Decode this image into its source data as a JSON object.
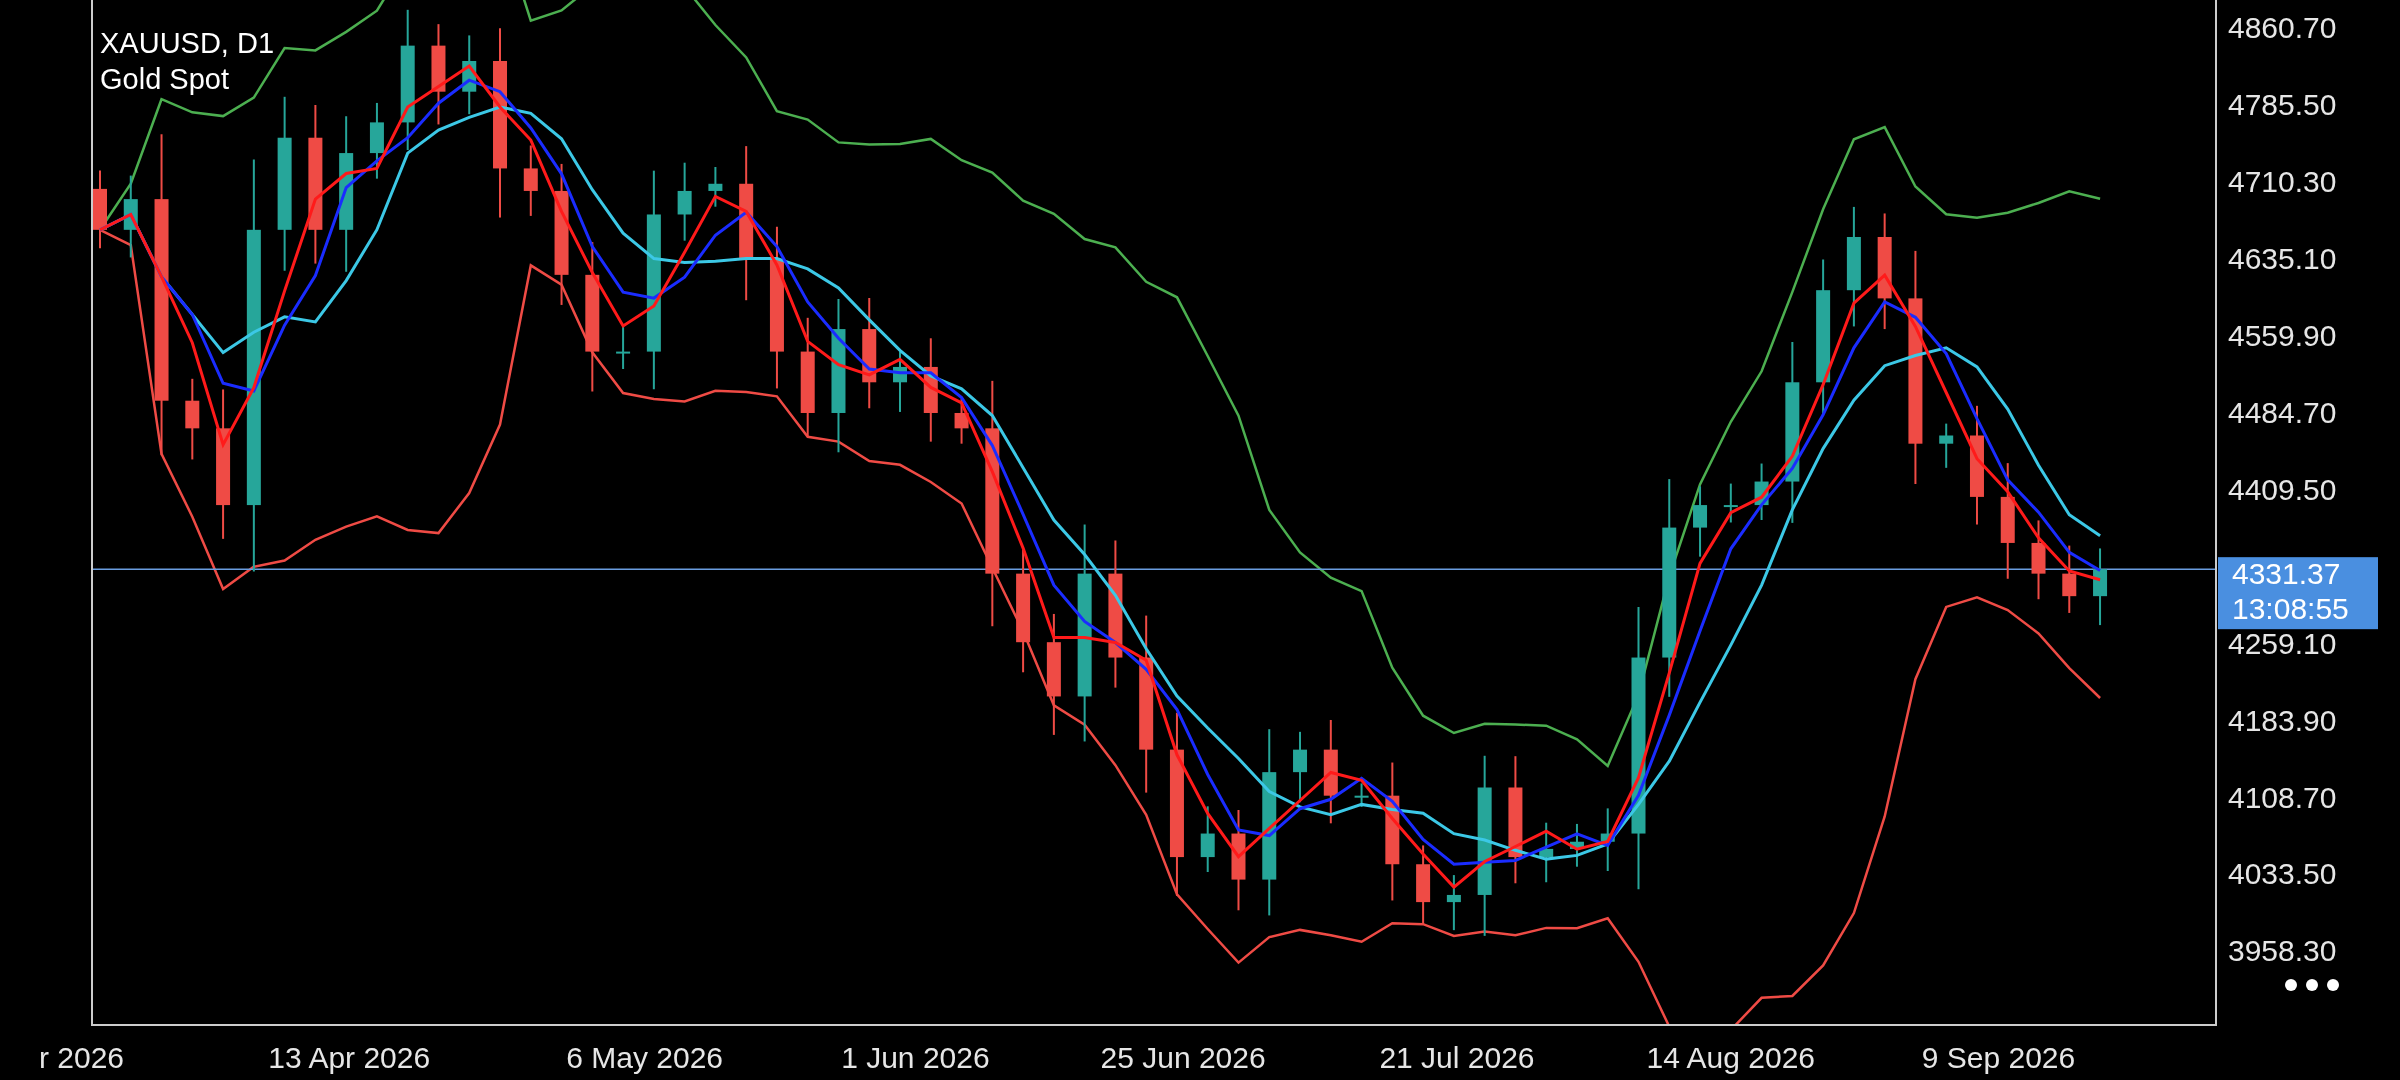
{
  "chart": {
    "symbol": "XAUUSD, D1",
    "description": "Gold Spot",
    "current_price": "4331.37",
    "countdown": "13:08:55",
    "price_axis_labels": [
      "4860.70",
      "4785.50",
      "4710.30",
      "4635.10",
      "4559.90",
      "4484.70",
      "4409.50",
      "4259.10",
      "4183.90",
      "4108.70",
      "4033.50",
      "3958.30"
    ],
    "date_axis_labels": [
      "r 2026",
      "13 Apr 2026",
      "6 May 2026",
      "1 Jun 2026",
      "25 Jun 2026",
      "21 Jul 2026",
      "14 Aug 2026",
      "9 Sep 2026"
    ]
  }
}
